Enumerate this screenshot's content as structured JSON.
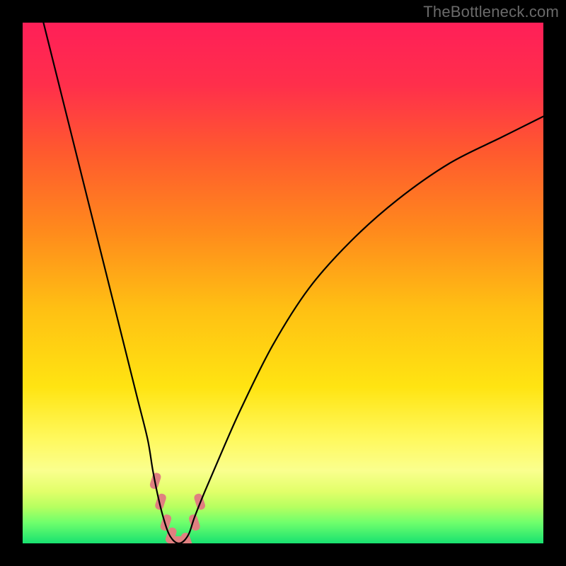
{
  "watermark": "TheBottleneck.com",
  "chart_data": {
    "type": "line",
    "title": "",
    "xlabel": "",
    "ylabel": "",
    "xlim": [
      0,
      100
    ],
    "ylim": [
      0,
      100
    ],
    "background_gradient": {
      "stops": [
        {
          "y": 0,
          "color": "#ff1f58"
        },
        {
          "y": 12,
          "color": "#ff2f4b"
        },
        {
          "y": 25,
          "color": "#ff5a2e"
        },
        {
          "y": 40,
          "color": "#ff8a1c"
        },
        {
          "y": 55,
          "color": "#ffc013"
        },
        {
          "y": 70,
          "color": "#ffe412"
        },
        {
          "y": 80,
          "color": "#fff95e"
        },
        {
          "y": 86,
          "color": "#faff8e"
        },
        {
          "y": 90,
          "color": "#e2ff6a"
        },
        {
          "y": 93,
          "color": "#b6ff60"
        },
        {
          "y": 96,
          "color": "#6fff6c"
        },
        {
          "y": 100,
          "color": "#18e270"
        }
      ]
    },
    "series": [
      {
        "name": "bottleneck-curve",
        "x": [
          4,
          6,
          8,
          10,
          12,
          14,
          16,
          18,
          20,
          22,
          24,
          25,
          26,
          27,
          28,
          29,
          30,
          31,
          32,
          33,
          35,
          38,
          42,
          48,
          55,
          63,
          72,
          82,
          92,
          100
        ],
        "y": [
          100,
          92,
          84,
          76,
          68,
          60,
          52,
          44,
          36,
          28,
          20,
          14,
          9,
          5,
          2,
          0.5,
          0,
          0.5,
          2,
          5,
          10,
          17,
          26,
          38,
          49,
          58,
          66,
          73,
          78,
          82
        ]
      }
    ],
    "markers": {
      "name": "highlight-range",
      "color": "#e08080",
      "points": [
        {
          "x": 25.5,
          "y": 12
        },
        {
          "x": 26.5,
          "y": 8
        },
        {
          "x": 27.5,
          "y": 4
        },
        {
          "x": 28.5,
          "y": 1.5
        },
        {
          "x": 30.0,
          "y": 0.5
        },
        {
          "x": 31.5,
          "y": 0.5
        },
        {
          "x": 33.0,
          "y": 4
        },
        {
          "x": 34.0,
          "y": 8
        }
      ]
    }
  }
}
